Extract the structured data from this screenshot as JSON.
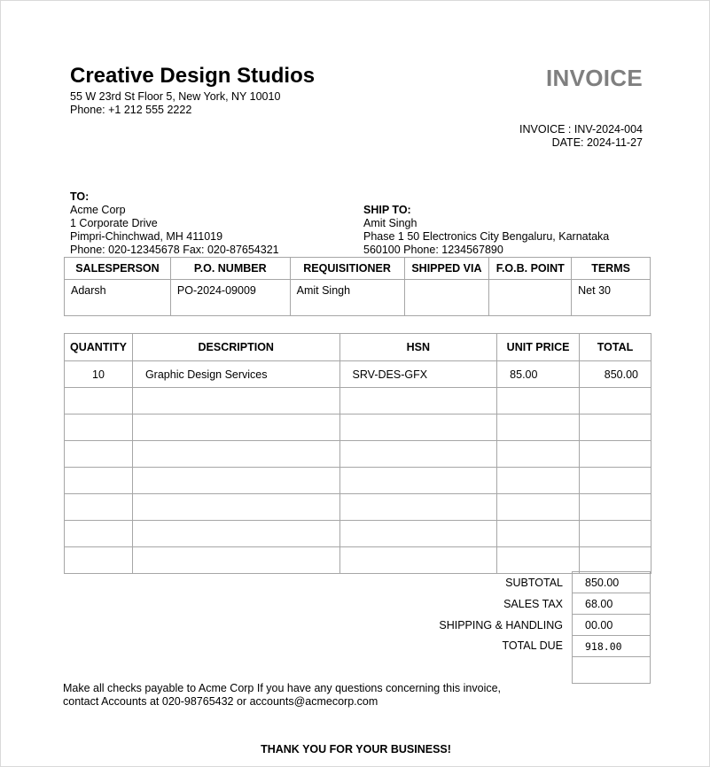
{
  "company": {
    "name": "Creative Design Studios",
    "address": "55 W 23rd St Floor 5, New York, NY 10010",
    "phone": "Phone: +1 212 555 2222"
  },
  "invoice": {
    "title": "INVOICE",
    "number_line": "INVOICE : INV-2024-004",
    "date_line": "DATE: 2024-11-27"
  },
  "bill_to": {
    "heading": "TO:",
    "name": "Acme Corp",
    "address1": "1 Corporate Drive",
    "address2": "Pimpri-Chinchwad, MH 411019",
    "contact": "Phone: 020-12345678 Fax: 020-87654321"
  },
  "ship_to": {
    "heading": "SHIP TO:",
    "name": "Amit Singh",
    "address1": "Phase 1 50 Electronics City Bengaluru, Karnataka",
    "address2": "560100 Phone: 1234567890"
  },
  "order_info": {
    "headers": [
      "SALESPERSON",
      "P.O. NUMBER",
      "REQUISITIONER",
      "SHIPPED VIA",
      "F.O.B. POINT",
      "TERMS"
    ],
    "values": [
      "Adarsh",
      "PO-2024-09009",
      "Amit Singh",
      "",
      "",
      "Net 30"
    ]
  },
  "items": {
    "headers": [
      "QUANTITY",
      "DESCRIPTION",
      "HSN",
      "UNIT PRICE",
      "TOTAL"
    ],
    "rows": [
      [
        "10",
        "Graphic Design Services",
        "SRV-DES-GFX",
        "85.00",
        "850.00"
      ]
    ]
  },
  "totals": {
    "subtotal_label": "SUBTOTAL",
    "subtotal": "850.00",
    "tax_label": "SALES TAX",
    "tax": "68.00",
    "shipping_label": "SHIPPING & HANDLING",
    "shipping": "00.00",
    "due_label": "TOTAL DUE",
    "due": "918.00"
  },
  "footer": {
    "note1": "Make all checks payable to Acme Corp If you have any questions concerning this invoice,",
    "note2": "contact Accounts at 020-98765432 or accounts@acmecorp.com",
    "thanks": "THANK YOU FOR YOUR BUSINESS!"
  }
}
